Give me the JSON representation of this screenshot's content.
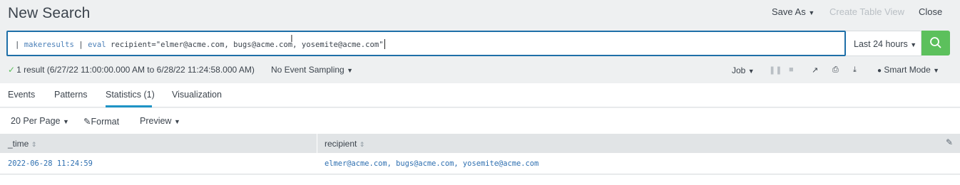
{
  "header": {
    "title": "New Search",
    "save_as": "Save As",
    "create_table_view": "Create Table View",
    "close": "Close"
  },
  "search": {
    "pipe1": "| ",
    "cmd1": "makeresults",
    "pipe2": " | ",
    "cmd2": "eval",
    "rest": " recipient=\"elmer@acme.com, bugs@acme.com, yosemite@acme.com\"",
    "time_range": "Last 24 hours"
  },
  "status": {
    "result_info": "1 result (6/27/22 11:00:00.000 AM to 6/28/22 11:24:58.000 AM)",
    "sampling": "No Event Sampling",
    "job": "Job",
    "mode": "Smart Mode"
  },
  "tabs": [
    {
      "label": "Events"
    },
    {
      "label": "Patterns"
    },
    {
      "label": "Statistics (1)"
    },
    {
      "label": "Visualization"
    }
  ],
  "options": {
    "per_page": "20 Per Page",
    "format": "Format",
    "preview": "Preview"
  },
  "table": {
    "columns": [
      "_time",
      "recipient"
    ],
    "rows": [
      {
        "time": "2022-06-28 11:24:59",
        "recipient": "elmer@acme.com, bugs@acme.com, yosemite@acme.com"
      }
    ]
  },
  "colors": {
    "accent": "#1e6fa8",
    "search_button": "#5cc05c",
    "link": "#2e6fb0",
    "tab_underline": "#1e93c6"
  }
}
